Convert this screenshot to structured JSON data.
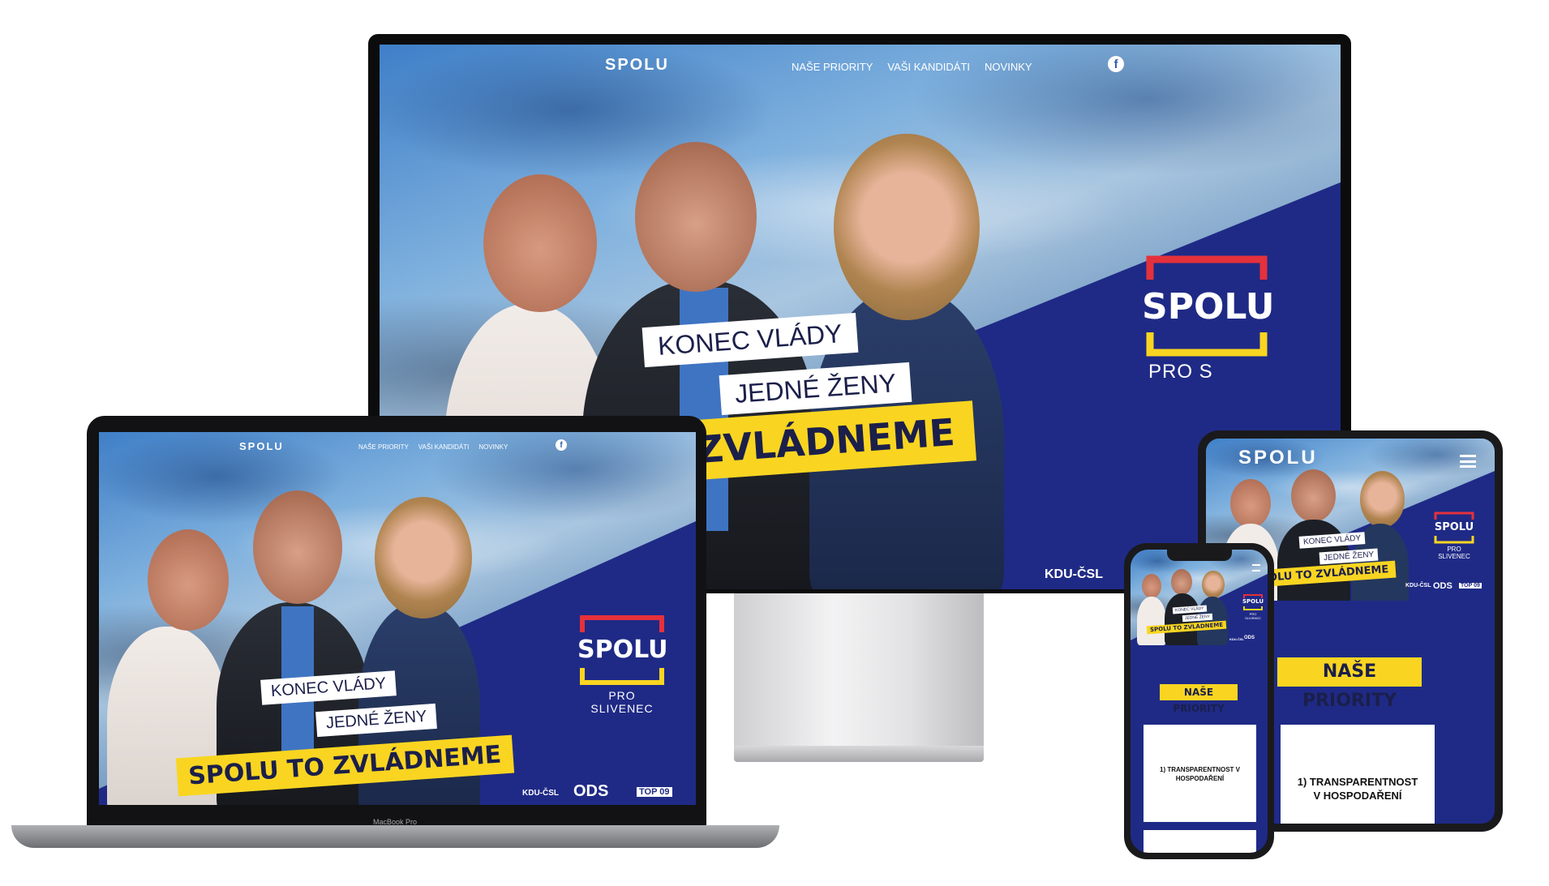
{
  "site": {
    "logo": "SPOLU",
    "nav": [
      "NAŠE PRIORITY",
      "VAŠI KANDIDÁTI",
      "NOVINKY"
    ],
    "facebook_glyph": "f",
    "slogan_line1": "KONEC VLÁDY",
    "slogan_line2": "JEDNÉ ŽENY",
    "headline": "SPOLU TO ZVLÁDNEME",
    "headline_partial": "TO ZVLÁDNEME",
    "brand_word": "SPOLU",
    "brand_sub": "PRO SLIVENEC",
    "brand_sub_partial": "PRO S",
    "partners": [
      "KDU-ČSL",
      "ODS",
      "TOP 09"
    ],
    "priorities_title": "NAŠE PRIORITY",
    "priority_1": "1) TRANSPARENTNOST V HOSPODAŘENÍ"
  },
  "laptop": {
    "label": "MacBook Pro"
  },
  "colors": {
    "navy": "#1f2a86",
    "yellow": "#f9d521",
    "red": "#e5313c",
    "sky": "#7fb1de"
  }
}
